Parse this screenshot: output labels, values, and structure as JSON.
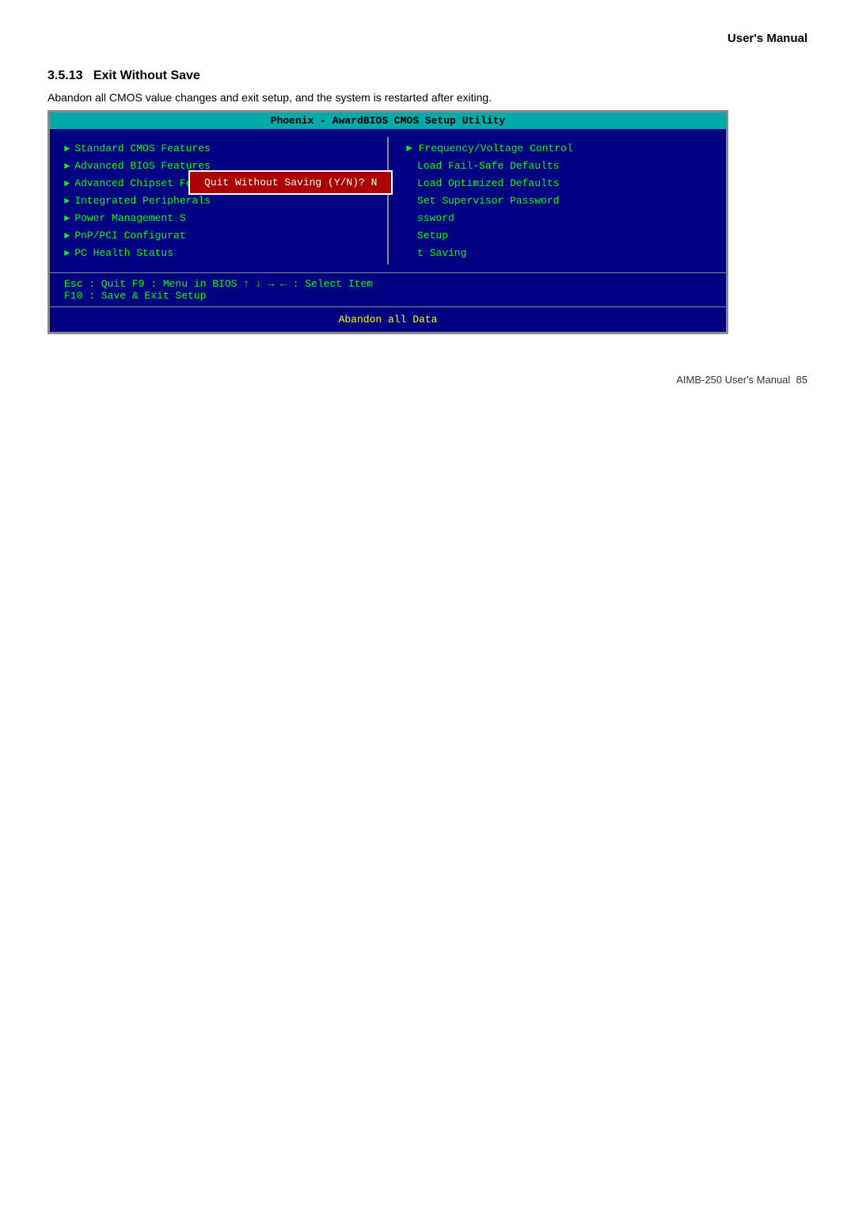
{
  "header": {
    "title": "User's  Manual"
  },
  "section": {
    "number": "3.5.13",
    "title": "Exit Without Save",
    "description": "Abandon all CMOS value changes and exit setup, and the system is restarted after exiting."
  },
  "bios": {
    "title_bar": "Phoenix - AwardBIOS CMOS Setup Utility",
    "left_menu": [
      "Standard CMOS Features",
      "Advanced BIOS Features",
      "Advanced Chipset Features",
      "Integrated Peripherals",
      "Power Management S",
      "PnP/PCI Configurat",
      "PC Health Status"
    ],
    "right_menu": [
      {
        "arrow": true,
        "label": "Frequency/Voltage Control"
      },
      {
        "arrow": false,
        "label": "Load Fail-Safe Defaults"
      },
      {
        "arrow": false,
        "label": "Load Optimized Defaults"
      },
      {
        "arrow": false,
        "label": "Set Supervisor Password"
      },
      {
        "arrow": false,
        "label": "ssword"
      },
      {
        "arrow": false,
        "label": "Setup"
      },
      {
        "arrow": false,
        "label": "t Saving"
      }
    ],
    "popup": {
      "text": "Quit Without Saving (Y/N)? N"
    },
    "footer_line1": "Esc : Quit       F9 : Menu in BIOS        ↑ ↓ → ←   : Select Item",
    "footer_line2": "F10 : Save & Exit Setup",
    "status_bar": "Abandon all Data"
  },
  "footer": {
    "product": "AIMB-250  User's  Manual",
    "page": "85"
  }
}
